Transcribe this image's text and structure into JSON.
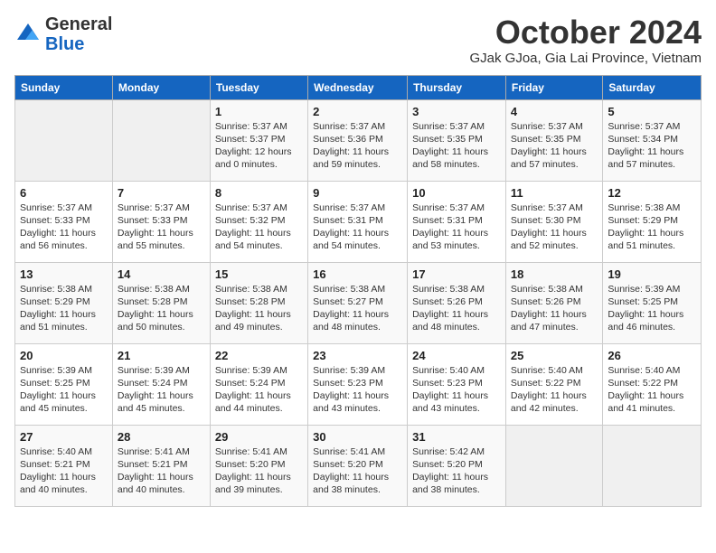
{
  "header": {
    "logo_general": "General",
    "logo_blue": "Blue",
    "month_title": "October 2024",
    "subtitle": "GJak GJoa, Gia Lai Province, Vietnam"
  },
  "weekdays": [
    "Sunday",
    "Monday",
    "Tuesday",
    "Wednesday",
    "Thursday",
    "Friday",
    "Saturday"
  ],
  "weeks": [
    [
      {
        "day": "",
        "info": ""
      },
      {
        "day": "",
        "info": ""
      },
      {
        "day": "1",
        "info": "Sunrise: 5:37 AM\nSunset: 5:37 PM\nDaylight: 12 hours and 0 minutes."
      },
      {
        "day": "2",
        "info": "Sunrise: 5:37 AM\nSunset: 5:36 PM\nDaylight: 11 hours and 59 minutes."
      },
      {
        "day": "3",
        "info": "Sunrise: 5:37 AM\nSunset: 5:35 PM\nDaylight: 11 hours and 58 minutes."
      },
      {
        "day": "4",
        "info": "Sunrise: 5:37 AM\nSunset: 5:35 PM\nDaylight: 11 hours and 57 minutes."
      },
      {
        "day": "5",
        "info": "Sunrise: 5:37 AM\nSunset: 5:34 PM\nDaylight: 11 hours and 57 minutes."
      }
    ],
    [
      {
        "day": "6",
        "info": "Sunrise: 5:37 AM\nSunset: 5:33 PM\nDaylight: 11 hours and 56 minutes."
      },
      {
        "day": "7",
        "info": "Sunrise: 5:37 AM\nSunset: 5:33 PM\nDaylight: 11 hours and 55 minutes."
      },
      {
        "day": "8",
        "info": "Sunrise: 5:37 AM\nSunset: 5:32 PM\nDaylight: 11 hours and 54 minutes."
      },
      {
        "day": "9",
        "info": "Sunrise: 5:37 AM\nSunset: 5:31 PM\nDaylight: 11 hours and 54 minutes."
      },
      {
        "day": "10",
        "info": "Sunrise: 5:37 AM\nSunset: 5:31 PM\nDaylight: 11 hours and 53 minutes."
      },
      {
        "day": "11",
        "info": "Sunrise: 5:37 AM\nSunset: 5:30 PM\nDaylight: 11 hours and 52 minutes."
      },
      {
        "day": "12",
        "info": "Sunrise: 5:38 AM\nSunset: 5:29 PM\nDaylight: 11 hours and 51 minutes."
      }
    ],
    [
      {
        "day": "13",
        "info": "Sunrise: 5:38 AM\nSunset: 5:29 PM\nDaylight: 11 hours and 51 minutes."
      },
      {
        "day": "14",
        "info": "Sunrise: 5:38 AM\nSunset: 5:28 PM\nDaylight: 11 hours and 50 minutes."
      },
      {
        "day": "15",
        "info": "Sunrise: 5:38 AM\nSunset: 5:28 PM\nDaylight: 11 hours and 49 minutes."
      },
      {
        "day": "16",
        "info": "Sunrise: 5:38 AM\nSunset: 5:27 PM\nDaylight: 11 hours and 48 minutes."
      },
      {
        "day": "17",
        "info": "Sunrise: 5:38 AM\nSunset: 5:26 PM\nDaylight: 11 hours and 48 minutes."
      },
      {
        "day": "18",
        "info": "Sunrise: 5:38 AM\nSunset: 5:26 PM\nDaylight: 11 hours and 47 minutes."
      },
      {
        "day": "19",
        "info": "Sunrise: 5:39 AM\nSunset: 5:25 PM\nDaylight: 11 hours and 46 minutes."
      }
    ],
    [
      {
        "day": "20",
        "info": "Sunrise: 5:39 AM\nSunset: 5:25 PM\nDaylight: 11 hours and 45 minutes."
      },
      {
        "day": "21",
        "info": "Sunrise: 5:39 AM\nSunset: 5:24 PM\nDaylight: 11 hours and 45 minutes."
      },
      {
        "day": "22",
        "info": "Sunrise: 5:39 AM\nSunset: 5:24 PM\nDaylight: 11 hours and 44 minutes."
      },
      {
        "day": "23",
        "info": "Sunrise: 5:39 AM\nSunset: 5:23 PM\nDaylight: 11 hours and 43 minutes."
      },
      {
        "day": "24",
        "info": "Sunrise: 5:40 AM\nSunset: 5:23 PM\nDaylight: 11 hours and 43 minutes."
      },
      {
        "day": "25",
        "info": "Sunrise: 5:40 AM\nSunset: 5:22 PM\nDaylight: 11 hours and 42 minutes."
      },
      {
        "day": "26",
        "info": "Sunrise: 5:40 AM\nSunset: 5:22 PM\nDaylight: 11 hours and 41 minutes."
      }
    ],
    [
      {
        "day": "27",
        "info": "Sunrise: 5:40 AM\nSunset: 5:21 PM\nDaylight: 11 hours and 40 minutes."
      },
      {
        "day": "28",
        "info": "Sunrise: 5:41 AM\nSunset: 5:21 PM\nDaylight: 11 hours and 40 minutes."
      },
      {
        "day": "29",
        "info": "Sunrise: 5:41 AM\nSunset: 5:20 PM\nDaylight: 11 hours and 39 minutes."
      },
      {
        "day": "30",
        "info": "Sunrise: 5:41 AM\nSunset: 5:20 PM\nDaylight: 11 hours and 38 minutes."
      },
      {
        "day": "31",
        "info": "Sunrise: 5:42 AM\nSunset: 5:20 PM\nDaylight: 11 hours and 38 minutes."
      },
      {
        "day": "",
        "info": ""
      },
      {
        "day": "",
        "info": ""
      }
    ]
  ]
}
